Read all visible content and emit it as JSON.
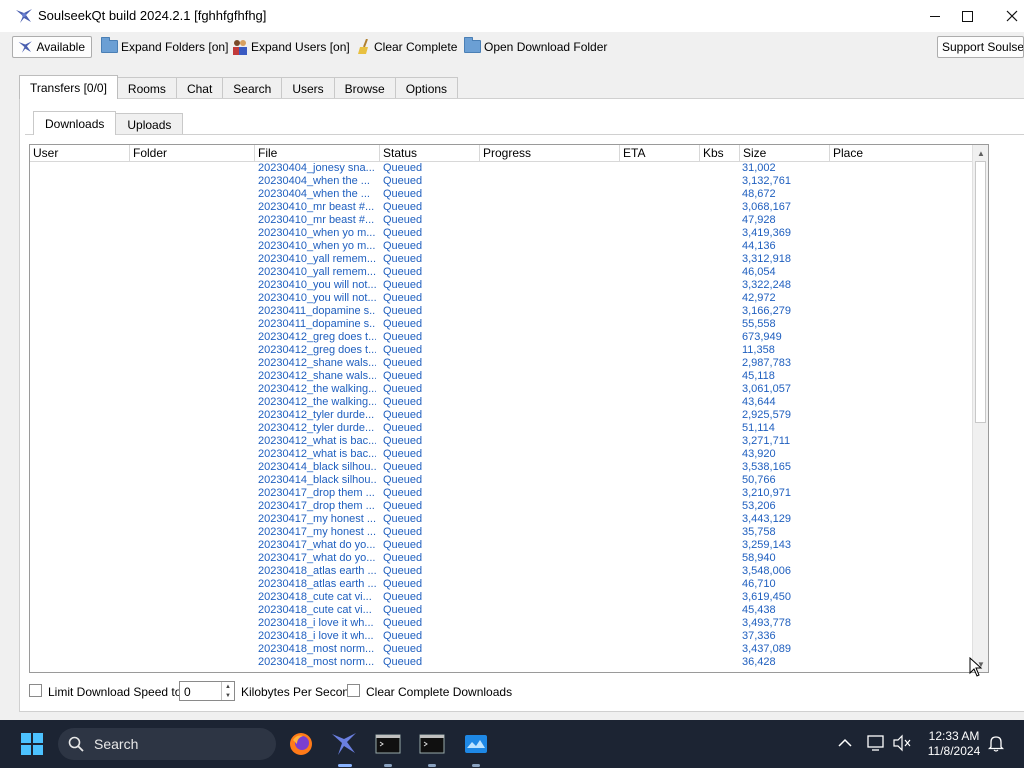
{
  "window": {
    "title": "SoulseekQt build 2024.2.1 [fghhfgfhfhg]"
  },
  "toolbar": {
    "available": "Available",
    "expand_folders": "Expand Folders [on]",
    "expand_users": "Expand Users [on]",
    "clear_complete": "Clear Complete",
    "open_download_folder": "Open Download Folder",
    "support": "Support Soulseek"
  },
  "tabs": [
    "Transfers [0/0]",
    "Rooms",
    "Chat",
    "Search",
    "Users",
    "Browse",
    "Options"
  ],
  "subtabs": [
    "Downloads",
    "Uploads"
  ],
  "columns": [
    "User",
    "Folder",
    "File",
    "Status",
    "Progress",
    "ETA",
    "Kbs",
    "Size",
    "Place"
  ],
  "rows": [
    {
      "file": "20230404_jonesy sna...",
      "status": "Queued",
      "size": "31,002"
    },
    {
      "file": "20230404_when the ...",
      "status": "Queued",
      "size": "3,132,761"
    },
    {
      "file": "20230404_when the ...",
      "status": "Queued",
      "size": "48,672"
    },
    {
      "file": "20230410_mr beast #...",
      "status": "Queued",
      "size": "3,068,167"
    },
    {
      "file": "20230410_mr beast #...",
      "status": "Queued",
      "size": "47,928"
    },
    {
      "file": "20230410_when yo m...",
      "status": "Queued",
      "size": "3,419,369"
    },
    {
      "file": "20230410_when yo m...",
      "status": "Queued",
      "size": "44,136"
    },
    {
      "file": "20230410_yall remem...",
      "status": "Queued",
      "size": "3,312,918"
    },
    {
      "file": "20230410_yall remem...",
      "status": "Queued",
      "size": "46,054"
    },
    {
      "file": "20230410_you will not...",
      "status": "Queued",
      "size": "3,322,248"
    },
    {
      "file": "20230410_you will not...",
      "status": "Queued",
      "size": "42,972"
    },
    {
      "file": "20230411_dopamine s...",
      "status": "Queued",
      "size": "3,166,279"
    },
    {
      "file": "20230411_dopamine s...",
      "status": "Queued",
      "size": "55,558"
    },
    {
      "file": "20230412_greg does t...",
      "status": "Queued",
      "size": "673,949"
    },
    {
      "file": "20230412_greg does t...",
      "status": "Queued",
      "size": "11,358"
    },
    {
      "file": "20230412_shane wals...",
      "status": "Queued",
      "size": "2,987,783"
    },
    {
      "file": "20230412_shane wals...",
      "status": "Queued",
      "size": "45,118"
    },
    {
      "file": "20230412_the walking...",
      "status": "Queued",
      "size": "3,061,057"
    },
    {
      "file": "20230412_the walking...",
      "status": "Queued",
      "size": "43,644"
    },
    {
      "file": "20230412_tyler durde...",
      "status": "Queued",
      "size": "2,925,579"
    },
    {
      "file": "20230412_tyler durde...",
      "status": "Queued",
      "size": "51,114"
    },
    {
      "file": "20230412_what is bac...",
      "status": "Queued",
      "size": "3,271,711"
    },
    {
      "file": "20230412_what is bac...",
      "status": "Queued",
      "size": "43,920"
    },
    {
      "file": "20230414_black silhou...",
      "status": "Queued",
      "size": "3,538,165"
    },
    {
      "file": "20230414_black silhou...",
      "status": "Queued",
      "size": "50,766"
    },
    {
      "file": "20230417_drop them ...",
      "status": "Queued",
      "size": "3,210,971"
    },
    {
      "file": "20230417_drop them ...",
      "status": "Queued",
      "size": "53,206"
    },
    {
      "file": "20230417_my honest ...",
      "status": "Queued",
      "size": "3,443,129"
    },
    {
      "file": "20230417_my honest ...",
      "status": "Queued",
      "size": "35,758"
    },
    {
      "file": "20230417_what do yo...",
      "status": "Queued",
      "size": "3,259,143"
    },
    {
      "file": "20230417_what do yo...",
      "status": "Queued",
      "size": "58,940"
    },
    {
      "file": "20230418_atlas earth ...",
      "status": "Queued",
      "size": "3,548,006"
    },
    {
      "file": "20230418_atlas earth ...",
      "status": "Queued",
      "size": "46,710"
    },
    {
      "file": "20230418_cute cat vi...",
      "status": "Queued",
      "size": "3,619,450"
    },
    {
      "file": "20230418_cute cat vi...",
      "status": "Queued",
      "size": "45,438"
    },
    {
      "file": "20230418_i love it wh...",
      "status": "Queued",
      "size": "3,493,778"
    },
    {
      "file": "20230418_i love it wh...",
      "status": "Queued",
      "size": "37,336"
    },
    {
      "file": "20230418_most norm...",
      "status": "Queued",
      "size": "3,437,089"
    },
    {
      "file": "20230418_most norm...",
      "status": "Queued",
      "size": "36,428"
    }
  ],
  "bottom": {
    "limit_label": "Limit Download Speed to",
    "speed_value": "0",
    "units_label": "Kilobytes Per Second",
    "clear_label": "Clear Complete Downloads"
  },
  "taskbar": {
    "search_label": "Search",
    "time": "12:33 AM",
    "date": "11/8/2024"
  },
  "colors": {
    "link_blue": "#1f5fbf",
    "taskbar_bg": "#1c2433"
  },
  "icons": [
    "soulseek-bird-icon",
    "folder-icon",
    "users-icon",
    "broom-icon",
    "search-icon",
    "firefox-icon",
    "terminal-icon",
    "windows-start-icon",
    "chevron-up-icon",
    "network-icon",
    "volume-muted-icon",
    "bell-icon"
  ]
}
